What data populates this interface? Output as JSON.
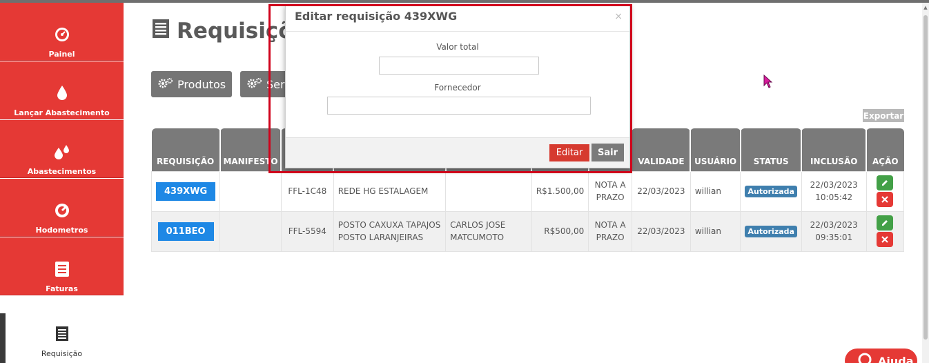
{
  "sidebar": {
    "items": [
      {
        "label": "Painel",
        "icon": "gauge-icon"
      },
      {
        "label": "Lançar Abastecimento",
        "icon": "drop-icon"
      },
      {
        "label": "Abastecimentos",
        "icon": "drops-icon"
      },
      {
        "label": "Hodometros",
        "icon": "odometer-icon"
      },
      {
        "label": "Faturas",
        "icon": "invoice-icon"
      },
      {
        "label": "Requisição",
        "icon": "document-icon"
      }
    ],
    "accent": "#e53935"
  },
  "page": {
    "title": "Requisiçõ"
  },
  "toolbar": {
    "products_label": "Produtos",
    "services_label": "Serv",
    "export_label": "Exportar"
  },
  "table": {
    "headers": [
      "REQUISIÇÃO",
      "MANIFESTO",
      "",
      "",
      "",
      "",
      "",
      "VALIDADE",
      "USUÁRIO",
      "STATUS",
      "INCLUSÃO",
      "AÇÃO"
    ],
    "rows": [
      {
        "code": "439XWG",
        "manifest": "",
        "plate": "FFL-1C48",
        "station_1": "REDE HG ESTALAGEM",
        "station_2": "",
        "driver_1": "",
        "driver_2": "",
        "value": "R$1.500,00",
        "payment_1": "NOTA A",
        "payment_2": "PRAZO",
        "validity": "22/03/2023",
        "user": "willian",
        "status": "Autorizada",
        "included_date": "22/03/2023",
        "included_time": "10:05:42"
      },
      {
        "code": "011BEO",
        "manifest": "",
        "plate": "FFL-5594",
        "station_1": "POSTO CAXUXA TAPAJOS",
        "station_2": "POSTO LARANJEIRAS",
        "driver_1": "CARLOS JOSE",
        "driver_2": "MATCUMOTO",
        "value": "R$500,00",
        "payment_1": "NOTA A",
        "payment_2": "PRAZO",
        "validity": "22/03/2023",
        "user": "willian",
        "status": "Autorizada",
        "included_date": "22/03/2023",
        "included_time": "09:35:01"
      }
    ]
  },
  "modal": {
    "title": "Editar requisição 439XWG",
    "close": "×",
    "total_label": "Valor total",
    "total_value": "",
    "supplier_label": "Fornecedor",
    "supplier_value": "",
    "edit_label": "Editar",
    "exit_label": "Sair"
  },
  "help": {
    "label": "Ajuda"
  }
}
